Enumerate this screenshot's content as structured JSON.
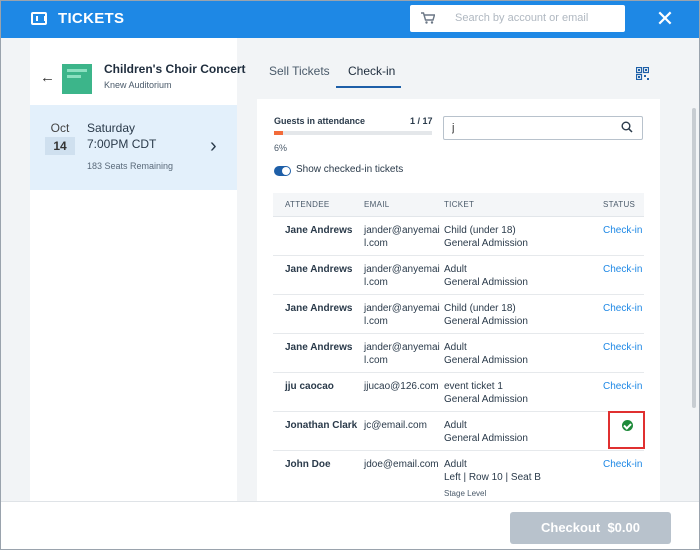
{
  "header": {
    "title": "TICKETS",
    "search_placeholder": "Search by account or email",
    "close_glyph": "✕"
  },
  "event": {
    "name": "Children's Choir Concert",
    "venue": "Knew Auditorium",
    "date_month": "Oct",
    "date_day": "14",
    "weekday": "Saturday",
    "time": "7:00PM CDT",
    "seats": "183 Seats Remaining"
  },
  "tabs": {
    "sell": "Sell Tickets",
    "checkin": "Check-in"
  },
  "attendance": {
    "label": "Guests in attendance",
    "count": "1 / 17",
    "percent_text": "6%",
    "fraction": 0.06
  },
  "filter": {
    "value": "j"
  },
  "toggle": {
    "label": "Show checked-in tickets",
    "on": true
  },
  "table": {
    "headers": [
      "ATTENDEE",
      "EMAIL",
      "TICKET",
      "STATUS"
    ],
    "rows": [
      {
        "name": "Jane Andrews",
        "email": "jander@anyemail.com",
        "ticket": "Child (under 18)",
        "ticket2": "General Admission",
        "status": "Check-in"
      },
      {
        "name": "Jane Andrews",
        "email": "jander@anyemail.com",
        "ticket": "Adult",
        "ticket2": "General Admission",
        "status": "Check-in"
      },
      {
        "name": "Jane Andrews",
        "email": "jander@anyemail.com",
        "ticket": "Child (under 18)",
        "ticket2": "General Admission",
        "status": "Check-in"
      },
      {
        "name": "Jane Andrews",
        "email": "jander@anyemail.com",
        "ticket": "Adult",
        "ticket2": "General Admission",
        "status": "Check-in"
      },
      {
        "name": "jju caocao",
        "email": "jjucao@126.com",
        "ticket": "event ticket 1",
        "ticket2": "General Admission",
        "status": "Check-in"
      },
      {
        "name": "Jonathan Clark",
        "email": "jc@email.com",
        "ticket": "Adult",
        "ticket2": "General Admission",
        "status": ""
      },
      {
        "name": "John Doe",
        "email": "jdoe@email.com",
        "ticket": "Adult",
        "ticket2": "Left | Row 10 | Seat B",
        "ticket3": "Stage Level",
        "status": "Check-in"
      }
    ]
  },
  "footer": {
    "checkout_label": "Checkout",
    "checkout_amount": "$0.00"
  },
  "colors": {
    "brand": "#1e88e5",
    "selected_date_bg": "#e3f0fb",
    "checked_green": "#1e8a3a",
    "highlight_red": "#e03030"
  }
}
